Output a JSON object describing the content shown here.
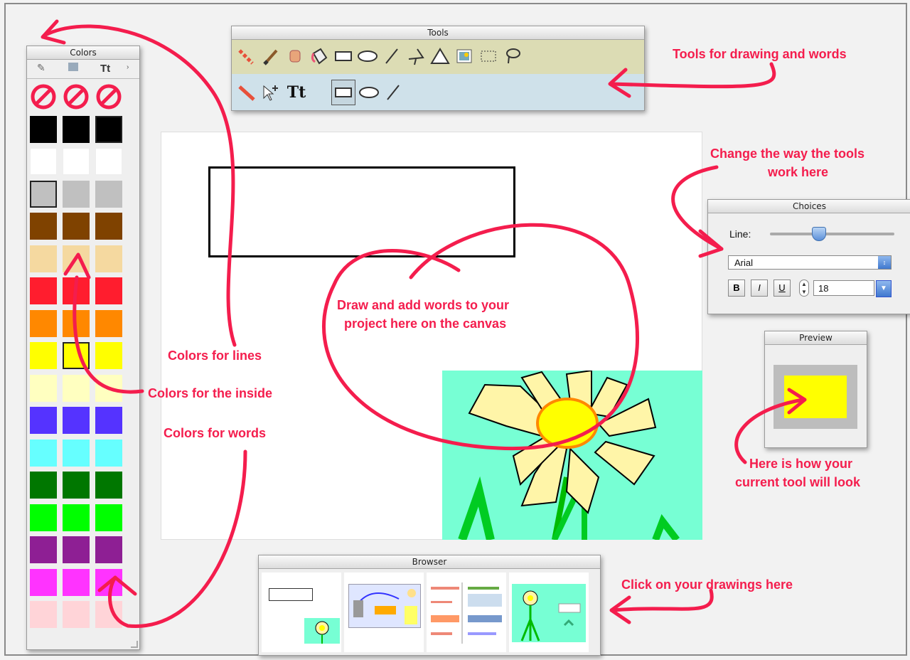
{
  "panels": {
    "colors": {
      "title": "Colors",
      "tab_text": "Tt"
    },
    "tools": {
      "title": "Tools"
    },
    "choices": {
      "title": "Choices",
      "line_label": "Line:",
      "font_value": "Arial",
      "bold_label": "B",
      "italic_label": "I",
      "underline_label": "U",
      "size_value": "18"
    },
    "preview": {
      "title": "Preview"
    },
    "browser": {
      "title": "Browser"
    }
  },
  "annotations": {
    "tools": "Tools for drawing and words",
    "choices_line1": "Change the way the tools",
    "choices_line2": "work here",
    "canvas_line1": "Draw and add words to your",
    "canvas_line2": "project here on the canvas",
    "lines": "Colors for lines",
    "inside": "Colors for the inside",
    "words": "Colors for words",
    "preview_line1": "Here is how your",
    "preview_line2": "current tool will look",
    "browser": "Click on your drawings here"
  },
  "tools": {
    "row1_icons": [
      "line-pattern-icon",
      "brush-icon",
      "stamp-icon",
      "paint-bucket-icon",
      "rectangle-icon",
      "ellipse-icon",
      "line-icon",
      "polygon-icon",
      "triangle-icon",
      "image-icon",
      "selection-icon",
      "lasso-icon"
    ],
    "row2_icons": [
      "pencil-icon",
      "select-arrow-icon",
      "text-tool-icon",
      "text-box-icon",
      "text-ellipse-icon",
      "text-line-icon"
    ],
    "text_tool_label": "Tt"
  },
  "palette": {
    "rows": [
      "none",
      "#000000",
      "#ffffff",
      "#c0c0c0",
      "#7f4200",
      "#f5d9a0",
      "#ff1d2e",
      "#ff8800",
      "#ffff00",
      "#ffffc0",
      "#5533ff",
      "#66ffff",
      "#007700",
      "#00ff00",
      "#8e1f94",
      "#ff33ff",
      "#ffd4d8"
    ],
    "selected": [
      [
        3,
        0
      ],
      [
        8,
        1
      ],
      [
        1,
        2
      ]
    ]
  },
  "colors": {
    "annotation": "#f41d4d",
    "canvas_bg": "#ffffff",
    "flower_bg": "#77ffd4"
  }
}
